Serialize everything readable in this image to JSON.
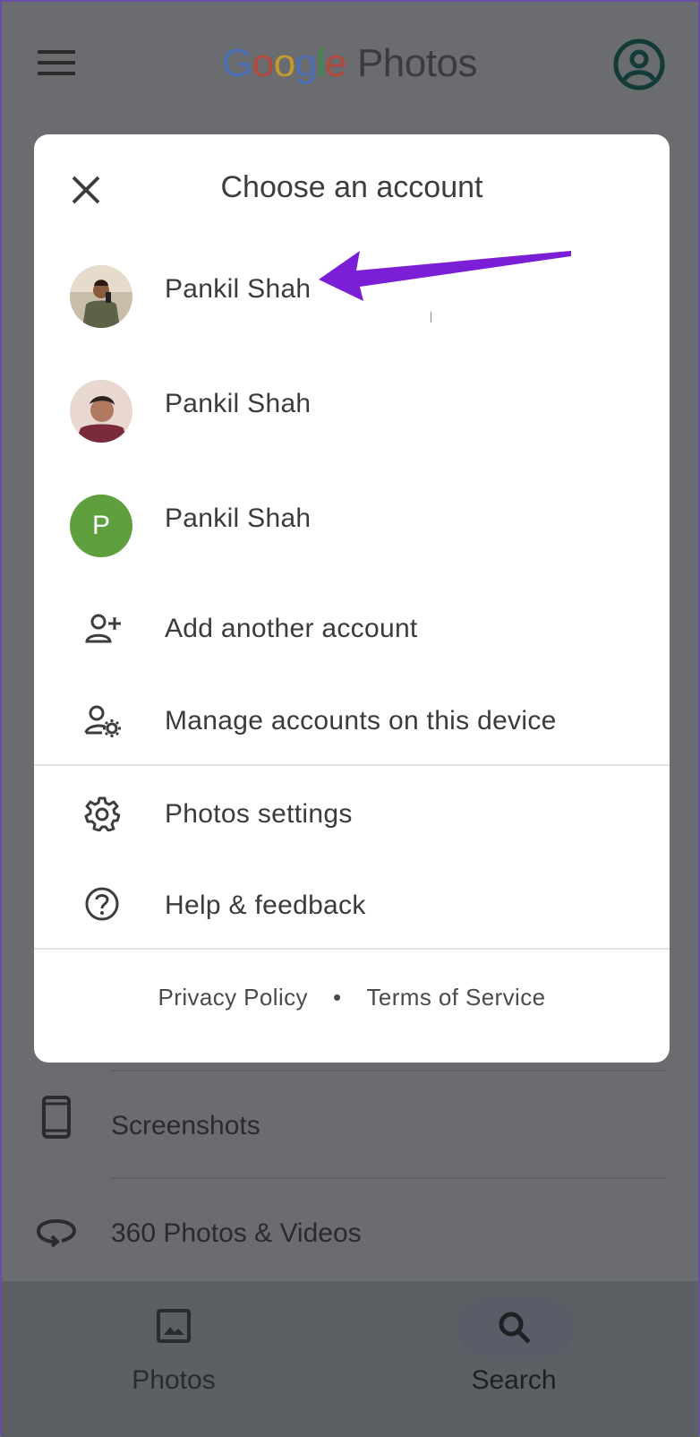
{
  "app": {
    "brand_google": [
      "G",
      "o",
      "o",
      "g",
      "l",
      "e"
    ],
    "brand_colors": [
      "#4a6fb3",
      "#b24a3e",
      "#c39a2e",
      "#4a6fb3",
      "#3d8a4a",
      "#b24a3e"
    ],
    "brand_photos": "Photos"
  },
  "dialog": {
    "title": "Choose an account",
    "accounts": [
      {
        "name": "Pankil Shah",
        "avatar": "photo"
      },
      {
        "name": "Pankil Shah",
        "avatar": "photo"
      },
      {
        "name": "Pankil Shah",
        "avatar": "P"
      }
    ],
    "actions": [
      {
        "label": "Add another account",
        "icon": "person-add-icon"
      },
      {
        "label": "Manage accounts on this device",
        "icon": "manage-accounts-icon"
      }
    ],
    "settings": [
      {
        "label": "Photos settings",
        "icon": "gear-icon"
      },
      {
        "label": "Help & feedback",
        "icon": "help-icon"
      }
    ],
    "footer": {
      "privacy": "Privacy Policy",
      "separator": "•",
      "terms": "Terms of Service"
    },
    "annotation_color": "#7a1fd6"
  },
  "background_list": [
    {
      "label": "Screenshots",
      "icon": "phone-icon"
    },
    {
      "label": "360 Photos & Videos",
      "icon": "360-icon"
    }
  ],
  "bottom_nav": {
    "photos": "Photos",
    "search": "Search",
    "active": "search"
  }
}
